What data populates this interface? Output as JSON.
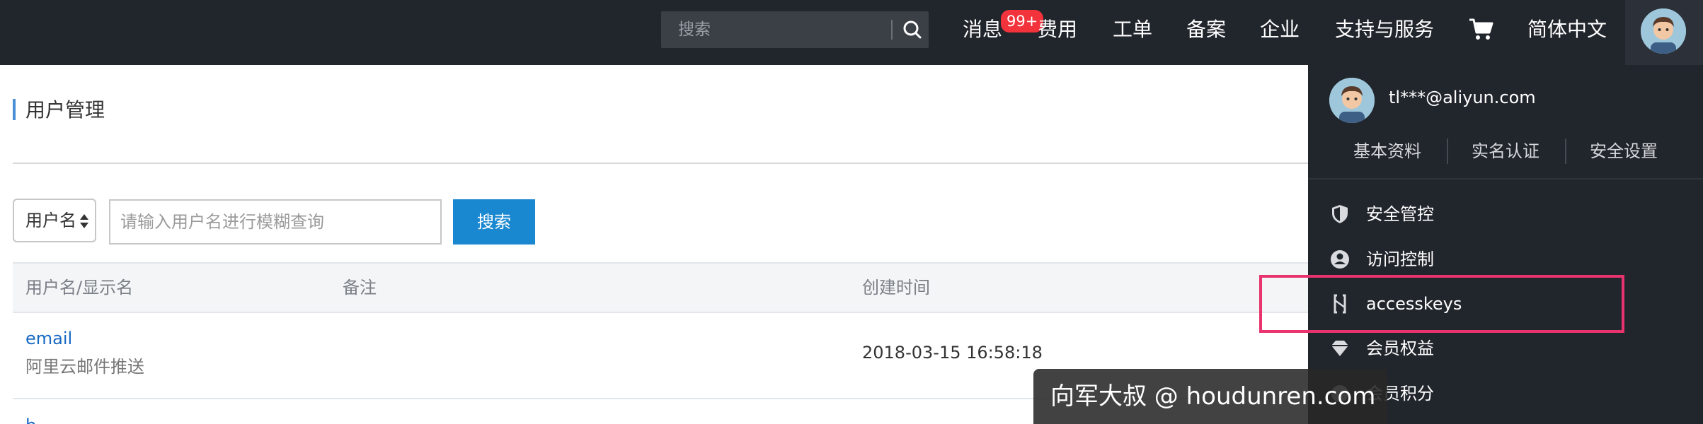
{
  "topbar": {
    "search_placeholder": "搜索",
    "nav": [
      "消息",
      "费用",
      "工单",
      "备案",
      "企业",
      "支持与服务"
    ],
    "badge": "99+",
    "language": "简体中文",
    "icons": [
      "search-icon",
      "cart-icon",
      "avatar-icon"
    ]
  },
  "page": {
    "title": "用户管理",
    "filter_select": "用户名",
    "filter_placeholder": "请输入用户名进行模糊查询",
    "search_button": "搜索"
  },
  "table": {
    "columns": [
      "用户名/显示名",
      "备注",
      "创建时间"
    ],
    "rows": [
      {
        "name": "email",
        "remark": "阿里云邮件推送",
        "created": "2018-03-15 16:58:18"
      }
    ],
    "partial_row_text": "b"
  },
  "dropdown": {
    "email": "tl***@aliyun.com",
    "links": [
      "基本资料",
      "实名认证",
      "安全设置"
    ],
    "items": [
      {
        "label": "安全管控",
        "icon": "shield-icon"
      },
      {
        "label": "访问控制",
        "icon": "user-circle-icon"
      },
      {
        "label": "accesskeys",
        "icon": "key-bracket-icon"
      },
      {
        "label": "会员权益",
        "icon": "diamond-icon"
      },
      {
        "label": "会员积分",
        "icon": "points-icon"
      }
    ]
  },
  "annotation": {
    "highlight_color": "#e8336e"
  },
  "watermark": "向军大叔 @ houdunren.com",
  "colors": {
    "topbar": "#21252c",
    "primary": "#1a88d0",
    "link": "#1769c4",
    "badge": "#f2333c"
  }
}
